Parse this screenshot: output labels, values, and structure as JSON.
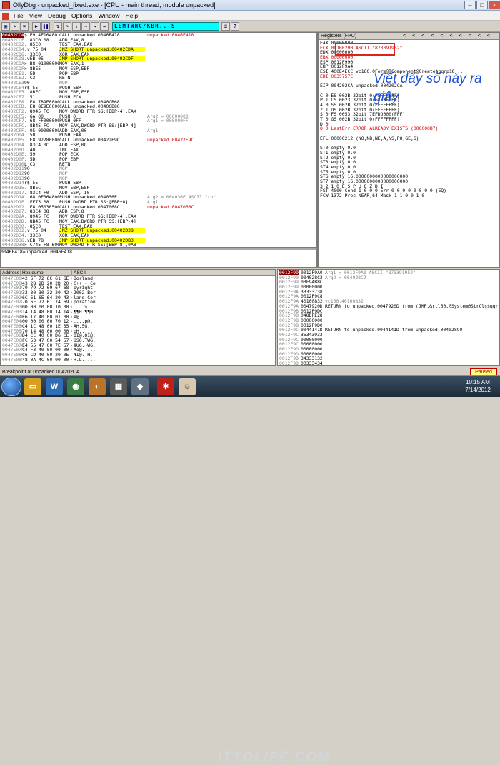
{
  "window": {
    "title": "OllyDbg - unpacked_fixed.exe - [CPU - main thread, module unpacked]"
  },
  "menu": [
    "File",
    "View",
    "Debug",
    "Options",
    "Window",
    "Help"
  ],
  "toolbar": {
    "letters": "LEMTWHC/KBR...S",
    "buttons": [
      "open",
      "restart",
      "close",
      "run",
      "pause",
      "step-into",
      "step-over",
      "trace-into",
      "trace-over",
      "execute-till-return",
      "goto"
    ]
  },
  "disasm": {
    "rows": [
      {
        "addr": "00402CCA",
        "hex": "$ E9 4E10400",
        "asm": "CALL unpacked.0046E418",
        "cmt": "unpacked.0046E418",
        "sel": true
      },
      {
        "addr": "00402CCF",
        "hex": ". 83C0 08",
        "asm": "ADD EAX,8",
        "cmt": ""
      },
      {
        "addr": "00402CD2",
        "hex": ". 85C0",
        "asm": "TEST EAX,EAX",
        "cmt": ""
      },
      {
        "addr": "00402CD4",
        "hex": ".v 75 04",
        "asm": "JNZ SHORT unpacked.00402CDA",
        "cmt": ""
      },
      {
        "addr": "00402CD6",
        "hex": ". 33C0",
        "asm": "XOR EAX,EAX",
        "cmt": ""
      },
      {
        "addr": "00402CD8",
        "hex": ".vEB 05",
        "asm": "JMP SHORT unpacked.00402CDF",
        "cmt": ""
      },
      {
        "addr": "00402CDA",
        "hex": "> B8 01000000",
        "asm": "MOV EAX,1",
        "cmt": ""
      },
      {
        "addr": "00402CDF",
        "hex": "> 8BE5",
        "asm": "MOV ESP,EBP",
        "cmt": ""
      },
      {
        "addr": "00402CE1",
        "hex": ". 5D",
        "asm": "POP EBP",
        "cmt": ""
      },
      {
        "addr": "00402CE2",
        "hex": ". C3",
        "asm": "RETN",
        "cmt": ""
      },
      {
        "addr": "00402CE3",
        "hex": "90",
        "asm": "NOP",
        "cmt": "",
        "grey": true
      },
      {
        "addr": "00402CE4",
        "hex": "r$ 55",
        "asm": "PUSH EBP",
        "cmt": ""
      },
      {
        "addr": "00402CE5",
        "hex": ". 8BEC",
        "asm": "MOV EBP,ESP",
        "cmt": ""
      },
      {
        "addr": "00402CE7",
        "hex": ". 51",
        "asm": "PUSH ECX",
        "cmt": ""
      },
      {
        "addr": "00402CE8",
        "hex": ". E8 7B9E0000",
        "asm": "CALL unpacked.0040CB68",
        "cmt": ""
      },
      {
        "addr": "00402CED",
        "hex": ". E8 8E9E0000",
        "asm": "CALL unpacked.0040CB80",
        "cmt": ""
      },
      {
        "addr": "00402CF2",
        "hex": ". 8945 FC",
        "asm": "MOV DWORD PTR SS:[EBP-4],EAX",
        "cmt": ""
      },
      {
        "addr": "00402CF5",
        "hex": ". 6A 00",
        "asm": "PUSH 0",
        "cmt": "Arg2 = 00000000",
        "cmtgrey": true
      },
      {
        "addr": "00402CF7",
        "hex": ". 68 FF000000",
        "asm": "PUSH 0FF",
        "cmt": "Arg1 = 000000FF",
        "cmtgrey": true
      },
      {
        "addr": "00402CFC",
        "hex": ". 8B45 FC",
        "asm": "MOV EAX,DWORD PTR SS:[EBP-4]",
        "cmt": ""
      },
      {
        "addr": "00402CFF",
        "hex": ". 05 00000000",
        "asm": "ADD EAX,00",
        "cmt": "Arg1",
        "cmtgrey": true
      },
      {
        "addr": "00402D04",
        "hex": ". 50",
        "asm": "PUSH EAX",
        "cmt": ""
      },
      {
        "addr": "00402D05",
        "hex": ". E8 92280000",
        "asm": "CALL unpacked.00422E9C",
        "cmt": "unpacked.00422E9C"
      },
      {
        "addr": "00402D0A",
        "hex": ". 83C4 0C",
        "asm": "ADD ESP,0C",
        "cmt": ""
      },
      {
        "addr": "00402D0D",
        "hex": ". 40",
        "asm": "INC EAX",
        "cmt": ""
      },
      {
        "addr": "00402D0E",
        "hex": ". 59",
        "asm": "POP ECX",
        "cmt": ""
      },
      {
        "addr": "00402D0F",
        "hex": ". 5D",
        "asm": "POP EBP",
        "cmt": ""
      },
      {
        "addr": "00402D10",
        "hex": "L C3",
        "asm": "RETN",
        "cmt": ""
      },
      {
        "addr": "00402D11",
        "hex": "90",
        "asm": "NOP",
        "cmt": "",
        "grey": true
      },
      {
        "addr": "00402D12",
        "hex": "90",
        "asm": "NOP",
        "cmt": "",
        "grey": true
      },
      {
        "addr": "00402D13",
        "hex": "90",
        "asm": "NOP",
        "cmt": "",
        "grey": true
      },
      {
        "addr": "00402D14",
        "hex": "r$ 55",
        "asm": "PUSH EBP",
        "cmt": ""
      },
      {
        "addr": "00402D15",
        "hex": ". 8BEC",
        "asm": "MOV EBP,ESP",
        "cmt": ""
      },
      {
        "addr": "00402D17",
        "hex": ". 83C4 F0",
        "asm": "ADD ESP,-10",
        "cmt": ""
      },
      {
        "addr": "00402D1A",
        "hex": ". 68 0E364000",
        "asm": "PUSH unpacked.004036E",
        "cmt": "Arg2 = 004036E ASCII \"rb\"",
        "cmtgrey": true
      },
      {
        "addr": "00402D1F",
        "hex": ". FF75 08",
        "asm": "PUSH DWORD PTR SS:[EBP+8]",
        "cmt": "Arg1",
        "cmtgrey": true
      },
      {
        "addr": "00402D22",
        "hex": ". E8 05030500",
        "asm": "CALL unpacked.0047068C",
        "cmt": "unpacked.0047068C"
      },
      {
        "addr": "00402D27",
        "hex": ". 83C4 08",
        "asm": "ADD ESP,8",
        "cmt": ""
      },
      {
        "addr": "00402D2A",
        "hex": ". 8945 FC",
        "asm": "MOV DWORD PTR SS:[EBP-4],EAX",
        "cmt": ""
      },
      {
        "addr": "00402D2D",
        "hex": ". 8B45 FC",
        "asm": "MOV EAX,DWORD PTR SS:[EBP-4]",
        "cmt": ""
      },
      {
        "addr": "00402D30",
        "hex": ". 85C0",
        "asm": "TEST EAX,EAX",
        "cmt": ""
      },
      {
        "addr": "00402D32",
        "hex": ".v 75 04",
        "asm": "JNZ SHORT unpacked.00402D38",
        "cmt": ""
      },
      {
        "addr": "00402D34",
        "hex": ". 33C0",
        "asm": "XOR EAX,EAX",
        "cmt": ""
      },
      {
        "addr": "00402D36",
        "hex": ".vEB 7B",
        "asm": "JMP SHORT unpacked.00402DB3",
        "cmt": ""
      },
      {
        "addr": "00402D38",
        "hex": "> C745 F8 6000",
        "asm": "MOV DWORD PTR SS:[EBP-8],0A8",
        "cmt": ""
      },
      {
        "addr": "00402D3F",
        "hex": ". E8 A0FFFFFF",
        "asm": "CALL unpacked.00402CE4",
        "cmt": ""
      }
    ],
    "info_line": "0046E418=unpacked.0046E418"
  },
  "registers": {
    "header": "Registers (FPU)",
    "lines": [
      "EAX 00000000",
      "ECX 001BF290 ASCII \"873391952\"",
      "EDX 00000000",
      "EBX 00000000",
      "ESP 0012F990",
      "EBP 0012F9A4",
      "ESI 400E4ECC vc160.0Form@TComponent@Create$qqrp18...",
      "EDI 0035757C",
      "",
      "EIP 004202CA unpacked.004202CA",
      "",
      "C 0  ES 002B 32bit 0(FFFFFFFF)",
      "P 1  CS 0023 32bit 0(FFFFFFFF)",
      "A 0  SS 002B 32bit 0(FFFFFFFF)",
      "Z 1  DS 002B 32bit 0(FFFFFFFF)",
      "S 0  FS 0053 32bit 7EFDD000(FFF)",
      "T 0  GS 002B 32bit 0(FFFFFFFF)",
      "D 0",
      "O 0  LastErr ERROR_ALREADY_EXISTS (000000B7)",
      "",
      "EFL 00000212 (NO,NB,NE,A,NS,PO,GE,G)",
      "",
      "ST0 empty 0.0",
      "ST1 empty 0.0",
      "ST2 empty 0.0",
      "ST3 empty 0.0",
      "ST4 empty 0.0",
      "ST5 empty 0.0",
      "ST6 empty 16.0000000000000000000",
      "ST7 empty 16.0000000000000000000",
      "               3 2 1 0      E S P U O Z D I",
      "FST 4000  Cond 1 0 0 0  Err 0 0 0 0 0 0 0 0  (EQ)",
      "FCW 1372  Prec NEAR,64  Mask    1 1 0 0 1 0"
    ]
  },
  "annotation": {
    "note": "Viết dãy số này ra giấy"
  },
  "dump": {
    "headers": [
      "Address",
      "Hex dump",
      "ASCII"
    ],
    "rows": [
      [
        "0047E000",
        "42 6F 72 6C 61 6E 64 20",
        "Borland "
      ],
      [
        "0047E008",
        "43 2B 2B 20 2D 20 43 6F",
        "C++ - Co"
      ],
      [
        "0047E010",
        "70 79 72 69 67 68 74 20",
        "pyright "
      ],
      [
        "0047E018",
        "32 30 30 32 20 42 6F 72",
        "2002 Bor"
      ],
      [
        "0047E020",
        "6C 61 6E 64 20 43 6F 72",
        "land Cor"
      ],
      [
        "0047E028",
        "70 6F 72 61 74 69 6F 6E",
        "poration"
      ],
      [
        "0047E030",
        "00 00 00 00 10 00 00 00",
        "....>..."
      ],
      [
        "0047E038",
        "14 14 48 00 14 14 48 00",
        "¶¶H.¶¶H."
      ],
      [
        "0047E040",
        "E6 17 40 00 01 00 00 00",
        "æ@....."
      ],
      [
        "0047E048",
        "00 00 00 00 70 12 40 00",
        "....p@."
      ],
      [
        "0047E050",
        "C4 1C 48 00 1E 35 47 00",
        "ÄH.5G."
      ],
      [
        "0047E058",
        "70 14 48 00 00 00 00 00",
        "pH....."
      ],
      [
        "0047E060",
        "D4 CE 40 00 D6 CE 40 00",
        "ÔÎ@.ÖÎ@."
      ],
      [
        "0047E068",
        "FC 53 47 00 54 57 47 00",
        "üSG.TWG."
      ],
      [
        "0047E070",
        "E4 55 47 00 7E 57 47 00",
        "äUG.~WG."
      ],
      [
        "0047E078",
        "C4 F3 40 00 00 00 00 00",
        "Äó@....."
      ],
      [
        "0047E080",
        "C6 CD 40 00 20 0E 48 00",
        "ÆÍ@. H."
      ],
      [
        "0047E088",
        "48 0A 4C 00 00 00 00 00",
        "H.L....."
      ]
    ]
  },
  "stack": {
    "rows": [
      [
        "0012F990",
        "0012F9A0",
        "Arg1 = 0012F9A0 ASCII \"873391952\""
      ],
      [
        "0012F994",
        "004028C2",
        "Arg2 = 004028C2"
      ],
      [
        "0012F998",
        "03F94B8C",
        ""
      ],
      [
        "0012F99C",
        "00000000",
        ""
      ],
      [
        "0012F9A0",
        "33333738",
        ""
      ],
      [
        "0012F9A4",
        "0012F9C8",
        ""
      ],
      [
        "0012F9A8",
        "40100832",
        "vc160.40100832"
      ],
      [
        "0012F9AC",
        "0047920D",
        "RETURN to unpacked.0047920D from (JMP.&rtl60.@System@StrCls$qqrpv)"
      ],
      [
        "0012F9B0",
        "0012F9DC",
        ""
      ],
      [
        "0012F9B4",
        "048DFE28",
        ""
      ],
      [
        "0012F9B8",
        "00000000",
        ""
      ],
      [
        "0012F9BC",
        "0012F9D0",
        ""
      ],
      [
        "0012F9C0",
        "0044141D",
        "RETURN to unpacked.0044141D from unpacked.004028C0"
      ],
      [
        "0012F9C4",
        "35343932",
        ""
      ],
      [
        "0012F9C8",
        "00000000",
        ""
      ],
      [
        "0012F9CC",
        "00000000",
        ""
      ],
      [
        "0012F9D0",
        "00000000",
        ""
      ],
      [
        "0012F9D4",
        "00000000",
        ""
      ],
      [
        "0012F9D8",
        "34333132",
        ""
      ],
      [
        "0012F9DC",
        "00333434",
        ""
      ]
    ]
  },
  "status": {
    "text": "Breakpoint at unpacked.004202CA",
    "state": "Paused"
  },
  "taskbar": {
    "time": "10:15 AM",
    "date": "7/14/2012",
    "watermark": "ITTOLIFE.COM"
  }
}
